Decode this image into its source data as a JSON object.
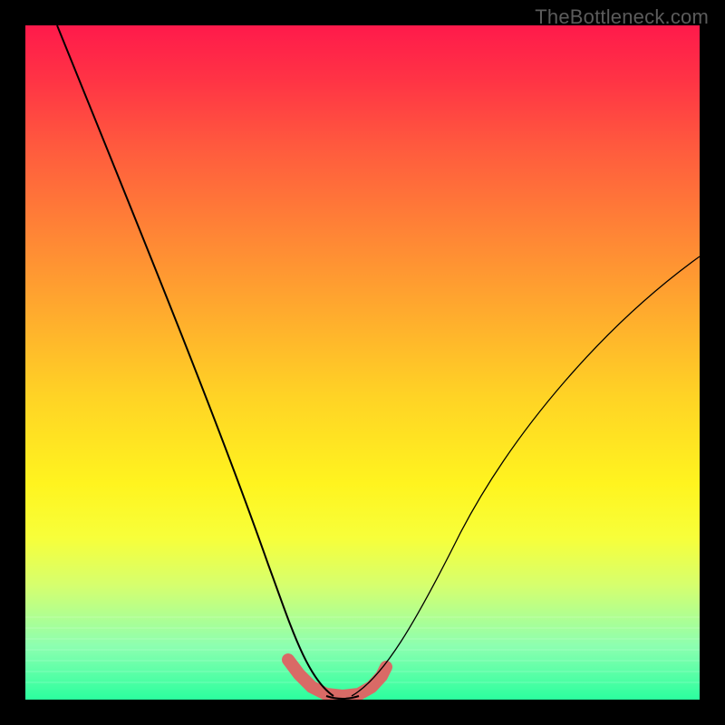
{
  "watermark": "TheBottleneck.com",
  "chart_data": {
    "type": "line",
    "title": "",
    "xlabel": "",
    "ylabel": "",
    "xlim": [
      0,
      100
    ],
    "ylim": [
      0,
      100
    ],
    "grid": false,
    "legend": false,
    "x": [
      0,
      5,
      10,
      15,
      20,
      25,
      30,
      33,
      36,
      39,
      41,
      43,
      45,
      47,
      49,
      51,
      55,
      60,
      65,
      70,
      75,
      80,
      85,
      90,
      95,
      100
    ],
    "series": [
      {
        "name": "bottleneck-curve",
        "values": [
          100,
          88,
          76,
          64,
          52,
          40,
          28,
          20,
          12,
          6,
          3,
          1,
          0,
          0,
          1,
          3,
          7,
          13,
          21,
          29,
          37,
          45,
          52,
          58,
          62,
          65
        ]
      }
    ],
    "annotations": [
      {
        "name": "valley-highlight",
        "x_range": [
          39,
          51
        ],
        "color": "#d96a66"
      }
    ],
    "background": "vertical-gradient red→yellow→green"
  }
}
